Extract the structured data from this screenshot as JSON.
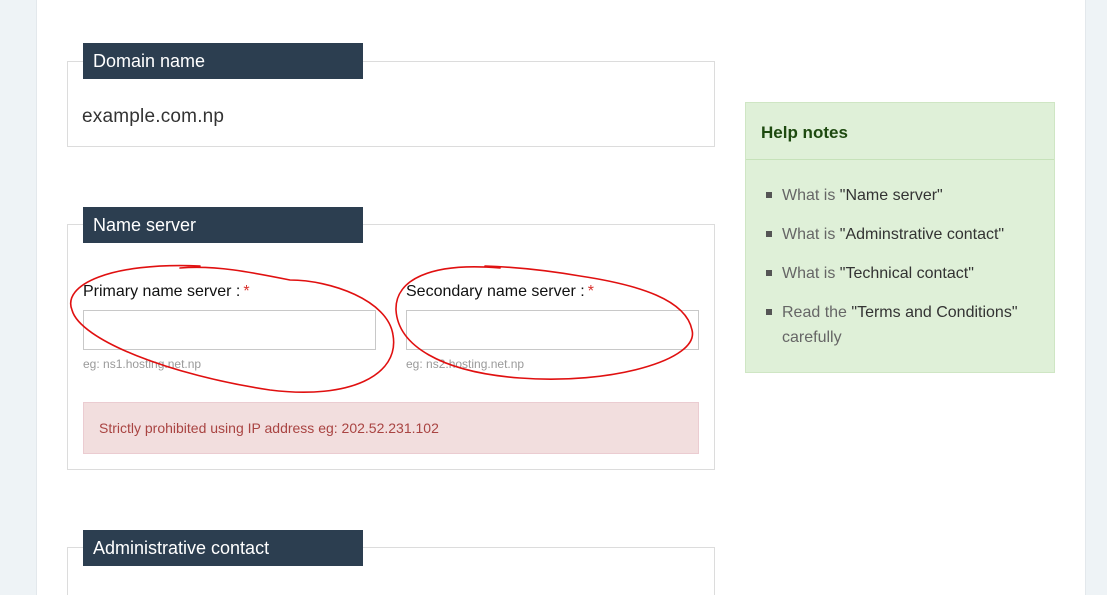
{
  "domain_section": {
    "heading": "Domain name",
    "value": "example.com.np"
  },
  "name_server_section": {
    "heading": "Name server",
    "primary": {
      "label": "Primary name server :",
      "required_mark": "*",
      "value": "",
      "hint": "eg: ns1.hosting.net.np"
    },
    "secondary": {
      "label": "Secondary name server :",
      "required_mark": "*",
      "value": "",
      "hint": "eg: ns2.hosting.net.np"
    },
    "warning": "Strictly prohibited using IP address eg: 202.52.231.102"
  },
  "admin_section": {
    "heading": "Administrative contact"
  },
  "help_notes": {
    "title": "Help notes",
    "items": [
      {
        "prefix": "What is ",
        "quoted": "\"Name server\"",
        "suffix": ""
      },
      {
        "prefix": "What is ",
        "quoted": "\"Adminstrative contact\"",
        "suffix": ""
      },
      {
        "prefix": "What is ",
        "quoted": "\"Technical contact\"",
        "suffix": ""
      },
      {
        "prefix": "Read the ",
        "quoted": "\"Terms and Conditions\"",
        "suffix": " carefully"
      }
    ]
  },
  "colors": {
    "heading_bg": "#2c3e50",
    "annotation_red": "#e01010",
    "help_bg": "#dff0d8",
    "alert_bg": "#f2dede"
  }
}
